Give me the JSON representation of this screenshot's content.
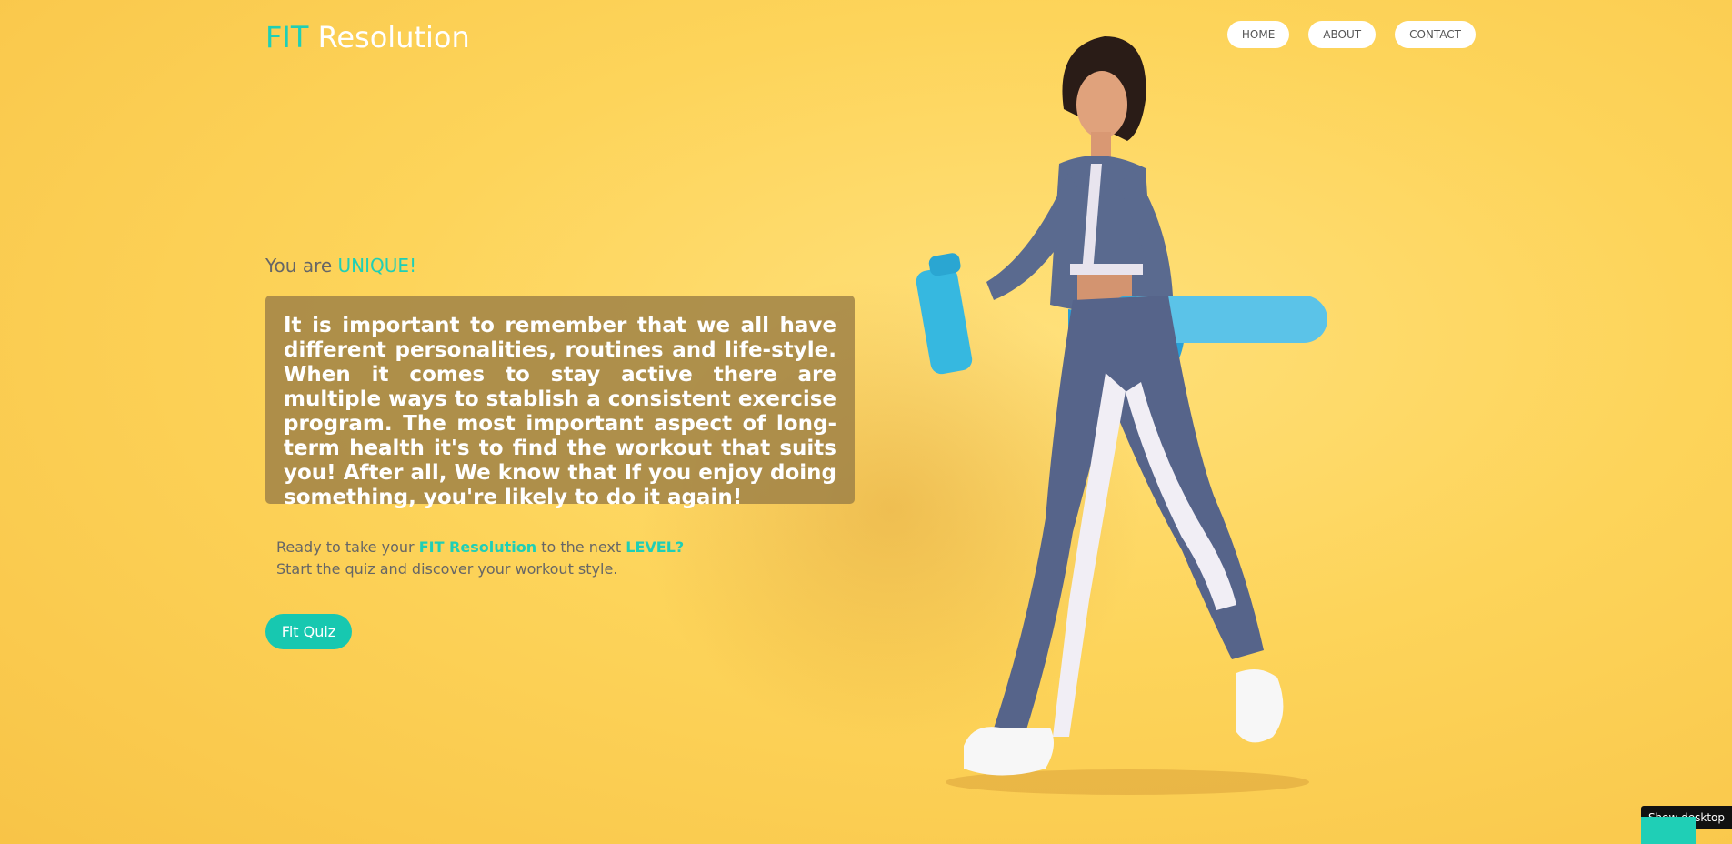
{
  "brand": {
    "accent": "FIT",
    "rest": "Resolution"
  },
  "nav": [
    {
      "label": "HOME"
    },
    {
      "label": "ABOUT"
    },
    {
      "label": "CONTACT"
    }
  ],
  "hero": {
    "tagline_prefix": "You are",
    "tagline_accent": "UNIQUE!",
    "body": "It is important to remember that we all have different personalities, routines and life-style. When it comes to stay active there are multiple ways to stablish a consistent exercise program. The most important aspect of long-term health it's to find the workout that suits you! After all, We know that If you enjoy doing something, you're likely to do it again!"
  },
  "cta": {
    "line1_a": "Ready to take your",
    "line1_brand": "FIT Resolution",
    "line1_b": "to the next",
    "line1_accent": "LEVEL?",
    "line2": "Start the quiz and discover your workout style."
  },
  "quiz_button": {
    "label": "Fit Quiz"
  },
  "system": {
    "show_desktop": "Show desktop"
  },
  "colors": {
    "accent": "#1fcfb6",
    "background": "#fdd45a",
    "card": "#a0824a"
  }
}
